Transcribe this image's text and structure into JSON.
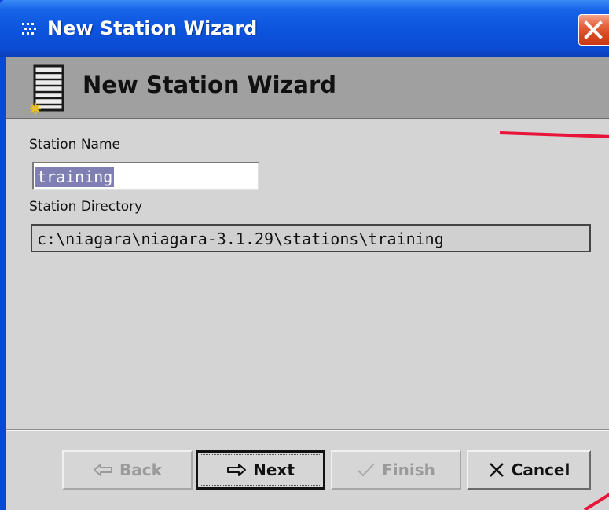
{
  "window": {
    "title": "New Station Wizard"
  },
  "header": {
    "title": "New Station Wizard"
  },
  "form": {
    "station_name_label": "Station Name",
    "station_name_value": "training",
    "station_directory_label": "Station Directory",
    "station_directory_value": "c:\\niagara\\niagara-3.1.29\\stations\\training"
  },
  "buttons": {
    "back_label": "Back",
    "next_label": "Next",
    "finish_label": "Finish",
    "cancel_label": "Cancel"
  },
  "icons": {
    "title_icon": "grid-dots-icon",
    "header_icon": "station-server-icon",
    "close_icon": "close-x-icon",
    "back_icon": "arrow-left-icon",
    "next_icon": "arrow-right-icon",
    "finish_icon": "checkmark-icon",
    "cancel_icon": "x-icon"
  },
  "colors": {
    "titlebar_blue": "#0d55de",
    "close_red": "#d6461e",
    "header_gray": "#a0a0a0",
    "client_gray": "#d4d4d4",
    "selection_highlight": "#7f7fb3",
    "annotation_red": "#e8143a"
  }
}
